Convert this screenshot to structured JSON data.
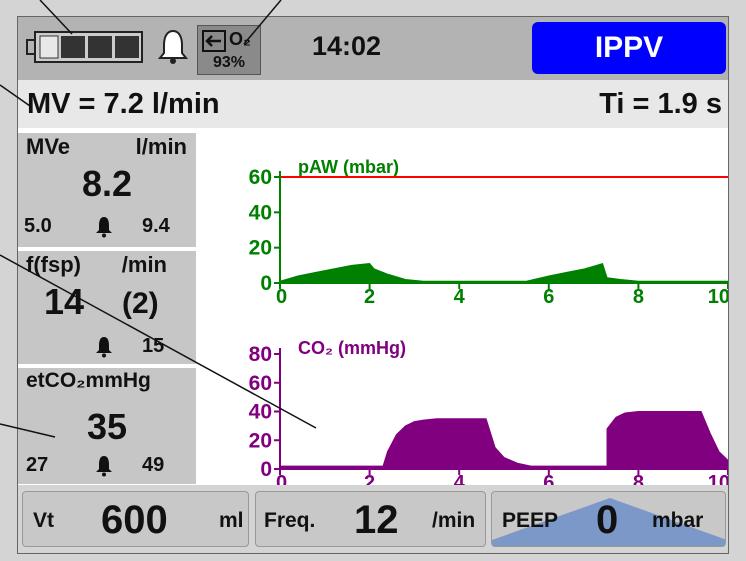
{
  "header": {
    "battery_icon": "battery-icon",
    "alarm_icon": "bell-icon",
    "o2_source_icon": "o2-supply-icon",
    "o2_label": "O₂",
    "o2_percent": "93%",
    "clock": "14:02",
    "mode": "IPPV",
    "mode_color": "#0000ff"
  },
  "info": {
    "mv": "MV = 7.2 l/min",
    "ti": "Ti = 1.9 s"
  },
  "panels": {
    "mve": {
      "label": "MVe",
      "unit": "l/min",
      "value": "8.2",
      "low": "5.0",
      "high": "9.4"
    },
    "freq": {
      "label": "f(fsp)",
      "unit": "/min",
      "value": "14",
      "spont": "(2)",
      "high": "15"
    },
    "etco2": {
      "label": "etCO₂",
      "unit": "mmHg",
      "value": "35",
      "low": "27",
      "high": "49"
    }
  },
  "settings": {
    "vt": {
      "label": "Vt",
      "value": "600",
      "unit": "ml"
    },
    "freq": {
      "label": "Freq.",
      "value": "12",
      "unit": "/min"
    },
    "peep": {
      "label": "PEEP",
      "value": "0",
      "unit": "mbar"
    }
  },
  "colors": {
    "pressure": "#008000",
    "pressure_limit": "#ff0000",
    "co2": "#800080"
  },
  "chart_data": [
    {
      "type": "area",
      "title": "pAW (mbar)",
      "xlim": [
        0,
        10
      ],
      "ylim": [
        0,
        60
      ],
      "xticks": [
        "0",
        "2",
        "4",
        "6",
        "8",
        "10"
      ],
      "yticks": [
        "0",
        "20",
        "40",
        "60"
      ],
      "limit_line": 60,
      "x": [
        0,
        0.4,
        0.8,
        1.2,
        1.6,
        2.0,
        2.1,
        2.4,
        2.8,
        3.2,
        5.5,
        6.0,
        6.4,
        6.8,
        7.2,
        7.3,
        7.6,
        8.0,
        10
      ],
      "y": [
        1,
        4,
        6,
        8,
        10,
        11,
        8,
        5,
        2,
        1,
        1,
        4,
        6,
        8,
        11,
        3,
        2,
        1,
        1
      ]
    },
    {
      "type": "area",
      "title": "CO₂ (mmHg)",
      "xlim": [
        0,
        10
      ],
      "ylim": [
        0,
        80
      ],
      "xticks": [
        "0",
        "2",
        "4",
        "6",
        "8",
        "10"
      ],
      "yticks": [
        "0",
        "20",
        "40",
        "60",
        "80"
      ],
      "x": [
        0,
        2.3,
        2.4,
        2.6,
        2.8,
        3.0,
        3.2,
        3.5,
        4.6,
        4.7,
        4.8,
        5.0,
        5.3,
        5.6,
        7.3,
        7.3,
        7.5,
        7.7,
        8.0,
        9.4,
        9.6,
        9.8,
        10
      ],
      "y": [
        2,
        2,
        12,
        24,
        30,
        33,
        34,
        35,
        35,
        25,
        15,
        8,
        4,
        2,
        2,
        28,
        36,
        39,
        40,
        40,
        25,
        12,
        6
      ]
    }
  ]
}
